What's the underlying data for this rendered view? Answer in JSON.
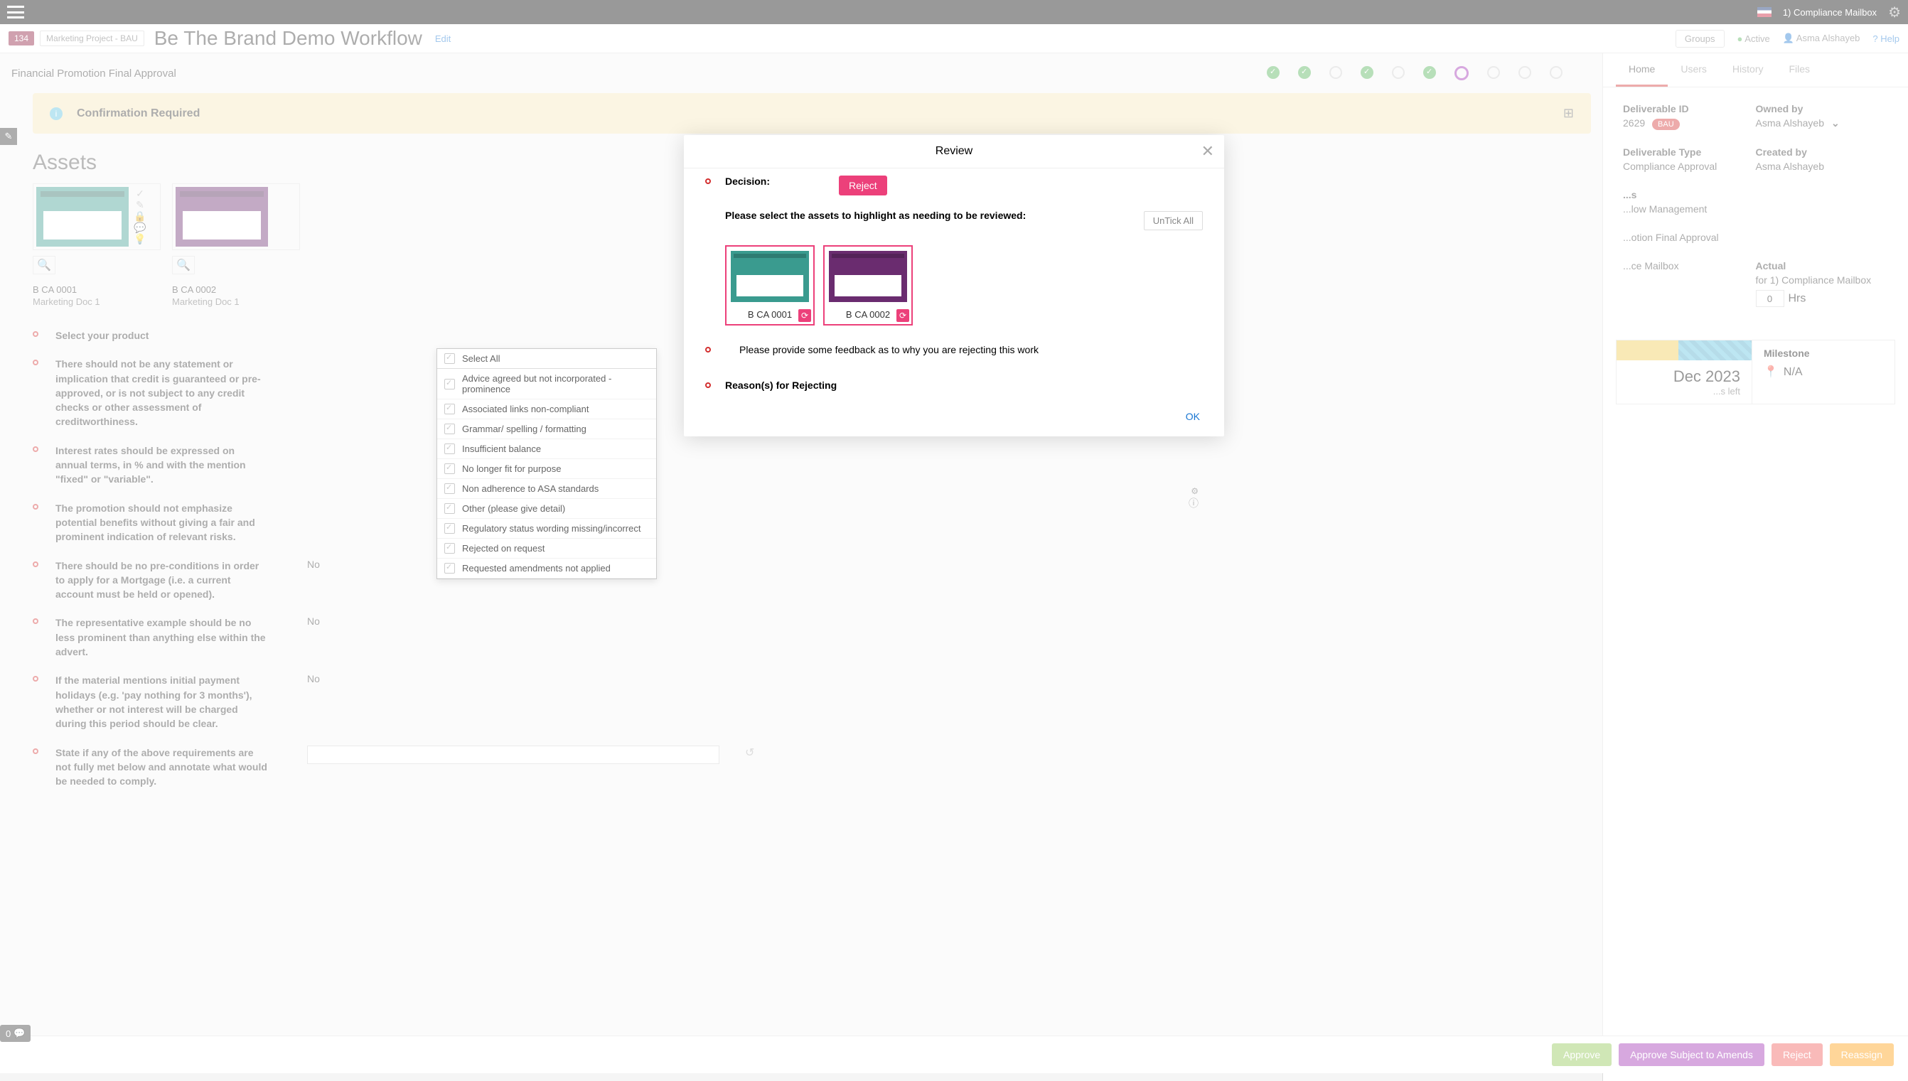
{
  "topbar": {
    "mailbox": "1) Compliance Mailbox"
  },
  "header": {
    "id": "134",
    "project": "Marketing Project - BAU",
    "title": "Be The Brand Demo Workflow",
    "edit": "Edit",
    "groups": "Groups",
    "active": "Active",
    "user": "Asma Alshayeb",
    "help": "Help"
  },
  "stage": {
    "label": "Financial Promotion Final Approval"
  },
  "confirm": {
    "text": "Confirmation Required"
  },
  "assets": {
    "title": "Assets",
    "items": [
      {
        "name": "B CA 0001",
        "sub": "Marketing Doc 1"
      },
      {
        "name": "B CA 0002",
        "sub": "Marketing Doc 1"
      }
    ]
  },
  "checklist": [
    {
      "text": "Select your product",
      "answer": ""
    },
    {
      "text": "There should not be any statement or implication that credit is guaranteed or pre-approved, or is not subject to any credit checks or other assessment of creditworthiness.",
      "answer": ""
    },
    {
      "text": "Interest rates should be expressed on annual terms, in % and with the mention \"fixed\" or \"variable\".",
      "answer": ""
    },
    {
      "text": "The promotion should not emphasize potential benefits without giving a fair and prominent indication of relevant risks.",
      "answer": ""
    },
    {
      "text": "There should be no pre-conditions in order to apply for a Mortgage (i.e. a current account must be held or opened).",
      "answer": "No"
    },
    {
      "text": "The representative example should be no less prominent than anything else within the advert.",
      "answer": "No"
    },
    {
      "text": "If the material mentions initial payment holidays (e.g. 'pay nothing for 3 months'), whether or not interest will be charged during this period should be clear.",
      "answer": "No"
    },
    {
      "text": "State if any of the above requirements are not fully met below and annotate what would be needed to comply.",
      "answer": "",
      "input": true
    }
  ],
  "right": {
    "tabs": [
      "Home",
      "Users",
      "History",
      "Files"
    ],
    "deliv_id_label": "Deliverable ID",
    "deliv_id": "2629",
    "bau": "BAU",
    "owned_label": "Owned by",
    "owned": "Asma Alshayeb",
    "type_label": "Deliverable Type",
    "type": "Compliance Approval",
    "created_label": "Created by",
    "created": "Asma Alshayeb",
    "wf_label_partial": "...s",
    "wf_val_partial": "...low Management",
    "stage_val_partial": "...otion Final Approval",
    "mailbox_partial": "...ce Mailbox",
    "actual_label": "Actual",
    "actual_for": "for",
    "actual_who": "1) Compliance Mailbox",
    "hrs_val": "0",
    "hrs_unit": "Hrs",
    "progress_date": "Dec 2023",
    "progress_sub": "...s left",
    "milestone_label": "Milestone",
    "milestone_val": "N/A"
  },
  "actions": {
    "approve": "Approve",
    "amends": "Approve Subject to Amends",
    "reject": "Reject",
    "reassign": "Reassign"
  },
  "chat_count": "0",
  "modal": {
    "title": "Review",
    "decision_label": "Decision:",
    "decision_value": "Reject",
    "select_assets": "Please select the assets to highlight as needing to be reviewed:",
    "untick": "UnTick All",
    "assets": [
      "B CA 0001",
      "B CA 0002"
    ],
    "feedback_label": "Please provide some feedback as to why you are rejecting this work",
    "reasons_label": "Reason(s) for Rejecting",
    "ok": "OK"
  },
  "dropdown": [
    "Select All",
    "Advice agreed but not incorporated - prominence",
    "Associated links non-compliant",
    "Grammar/ spelling / formatting",
    "Insufficient balance",
    "No longer fit for purpose",
    "Non adherence to ASA standards",
    "Other (please give detail)",
    "Regulatory status wording missing/incorrect",
    "Rejected on request",
    "Requested amendments not applied"
  ]
}
